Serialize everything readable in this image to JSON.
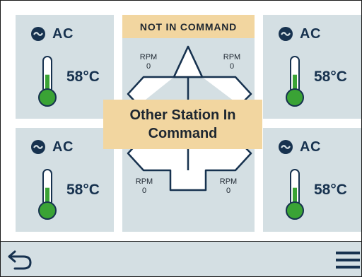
{
  "panels": [
    {
      "mode_label": "AC",
      "temperature": "58°C",
      "thermometer_fill": 0.55
    },
    {
      "mode_label": "AC",
      "temperature": "58°C",
      "thermometer_fill": 0.55
    },
    {
      "mode_label": "AC",
      "temperature": "58°C",
      "thermometer_fill": 0.55
    },
    {
      "mode_label": "AC",
      "temperature": "58°C",
      "thermometer_fill": 0.55
    }
  ],
  "status_banner": "NOT IN COMMAND",
  "engines": {
    "top_left": {
      "label": "RPM",
      "value": "0"
    },
    "top_right": {
      "label": "RPM",
      "value": "0"
    },
    "bottom_left": {
      "label": "RPM",
      "value": "0"
    },
    "bottom_right": {
      "label": "RPM",
      "value": "0"
    }
  },
  "overlay": {
    "line1": "Other Station In",
    "line2": "Command"
  },
  "icons": {
    "mode": "power-cycle-icon",
    "temperature": "thermometer-icon",
    "back": "back-arrow-icon",
    "menu": "hamburger-menu-icon"
  },
  "colors": {
    "panel_bg": "#d4dfe3",
    "text": "#17324f",
    "banner": "#f2d6a0",
    "thermo_fill": "#3aa335"
  }
}
